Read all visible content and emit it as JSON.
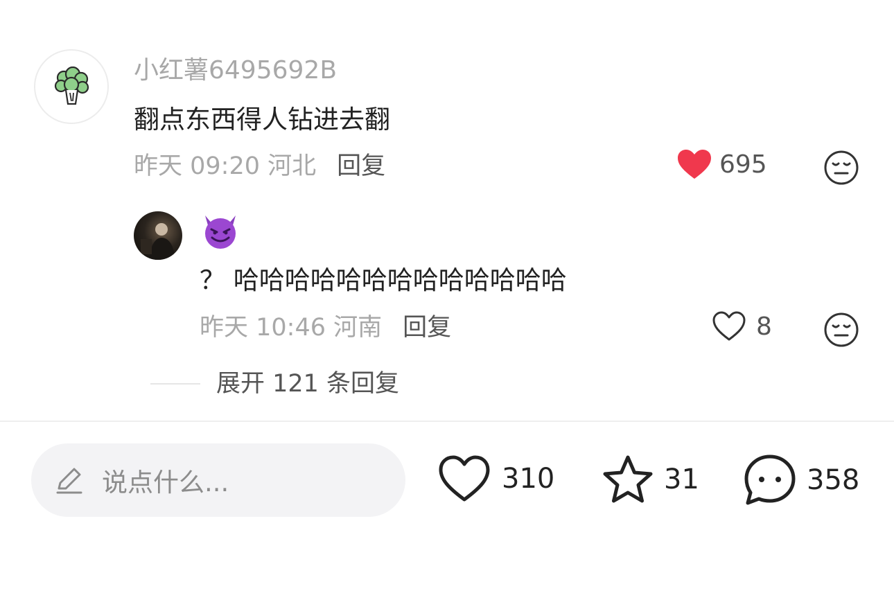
{
  "comment": {
    "avatar_icon": "broccoli-icon",
    "username": "小红薯6495692B",
    "text": "翻点东西得人钻进去翻",
    "meta": "昨天 09:20 河北",
    "reply_label": "回复",
    "like_count": "695",
    "liked": true,
    "like_color": "#f0384d"
  },
  "sub_reply": {
    "username_icon": "smiling-devil-emoji-icon",
    "text": "？ 哈哈哈哈哈哈哈哈哈哈哈哈哈",
    "meta": "昨天 10:46 河南",
    "reply_label": "回复",
    "like_count": "8"
  },
  "expand_label": "展开 121 条回复",
  "bottom_bar": {
    "input_placeholder": "说点什么...",
    "like_count": "310",
    "collect_count": "31",
    "comment_count": "358"
  }
}
